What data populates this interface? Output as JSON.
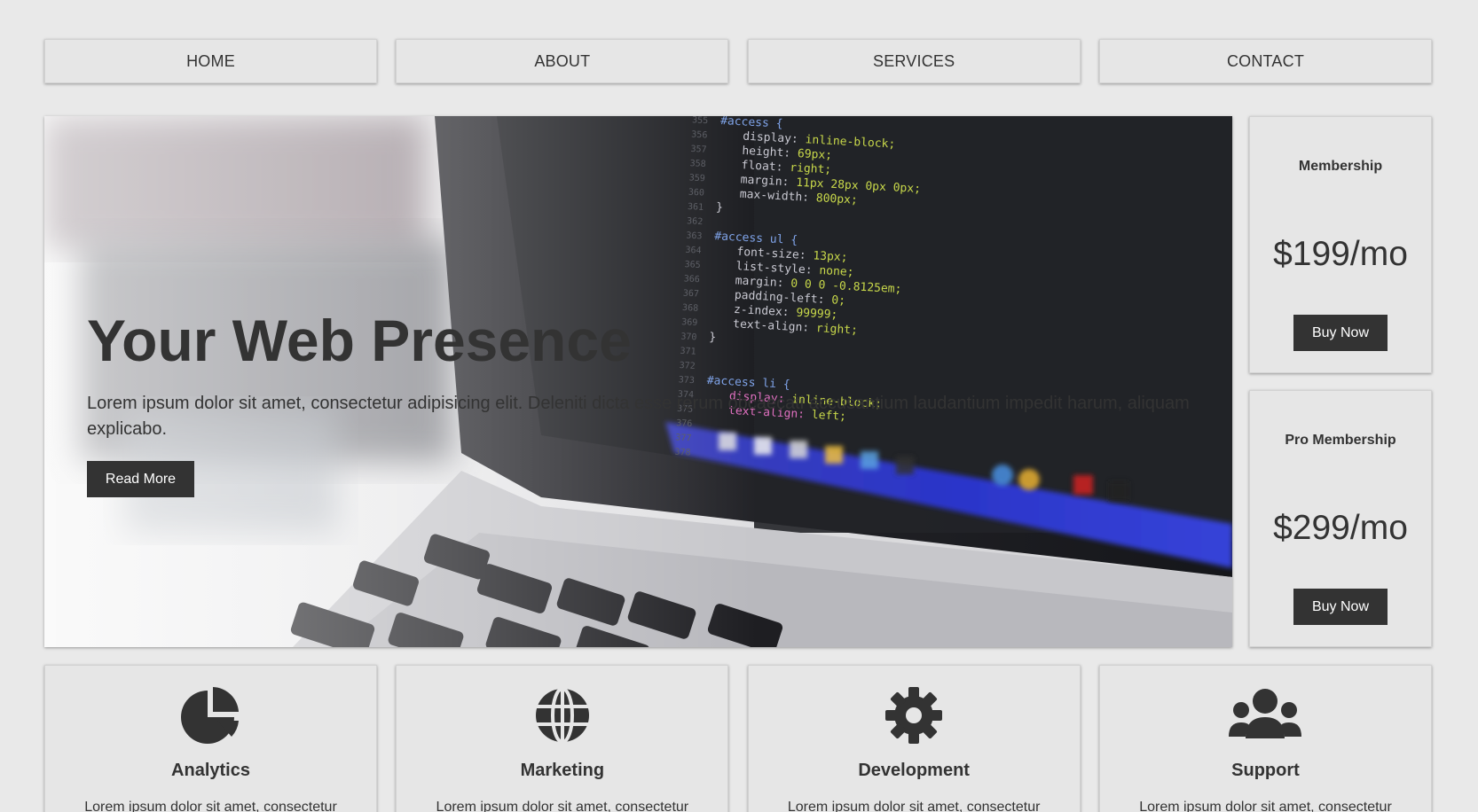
{
  "nav": {
    "items": [
      "HOME",
      "ABOUT",
      "SERVICES",
      "CONTACT"
    ]
  },
  "hero": {
    "title": "Your Web Presence",
    "text": "Lorem ipsum dolor sit amet, consectetur adipisicing elit. Deleniti dicta esse rerum obcaecati accusantium laudantium impedit harum, aliquam explicabo.",
    "button": "Read More",
    "code_lines": {
      "numbers": [
        "355",
        "356",
        "357",
        "358",
        "359",
        "360",
        "361",
        "362",
        "363",
        "364",
        "365",
        "366",
        "367",
        "368",
        "369",
        "370",
        "371",
        "372",
        "373",
        "374",
        "375",
        "376",
        "377",
        "378"
      ],
      "block1_selector": "#access {",
      "block1": [
        [
          "display: ",
          "inline-block;"
        ],
        [
          "height: ",
          "69px;"
        ],
        [
          "float: ",
          "right;"
        ],
        [
          "margin: ",
          "11px 28px 0px 0px;"
        ],
        [
          "max-width: ",
          "800px;"
        ]
      ],
      "block2_selector": "#access ul {",
      "block2": [
        [
          "font-size: ",
          "13px;"
        ],
        [
          "list-style: ",
          "none;"
        ],
        [
          "margin: ",
          "0 0 0 -0.8125em;"
        ],
        [
          "padding-left: ",
          "0;"
        ],
        [
          "z-index: ",
          "99999;"
        ],
        [
          "text-align: ",
          "right;"
        ]
      ],
      "block3_selector": "#access li {",
      "block3": [
        [
          "display: ",
          "inline-block;"
        ],
        [
          "text-align: ",
          "left;"
        ]
      ],
      "close": "}"
    }
  },
  "pricing": [
    {
      "title": "Membership",
      "price": "$199/mo",
      "button": "Buy Now"
    },
    {
      "title": "Pro Membership",
      "price": "$299/mo",
      "button": "Buy Now"
    }
  ],
  "features": [
    {
      "icon": "pie-chart-icon",
      "title": "Analytics",
      "text": "Lorem ipsum dolor sit amet, consectetur"
    },
    {
      "icon": "globe-icon",
      "title": "Marketing",
      "text": "Lorem ipsum dolor sit amet, consectetur"
    },
    {
      "icon": "gear-icon",
      "title": "Development",
      "text": "Lorem ipsum dolor sit amet, consectetur"
    },
    {
      "icon": "users-icon",
      "title": "Support",
      "text": "Lorem ipsum dolor sit amet, consectetur"
    }
  ],
  "colors": {
    "page_bg": "#e9e9e9",
    "card_bg": "#e6e6e6",
    "text": "#333333",
    "button_bg": "#333333",
    "button_text": "#ffffff"
  }
}
